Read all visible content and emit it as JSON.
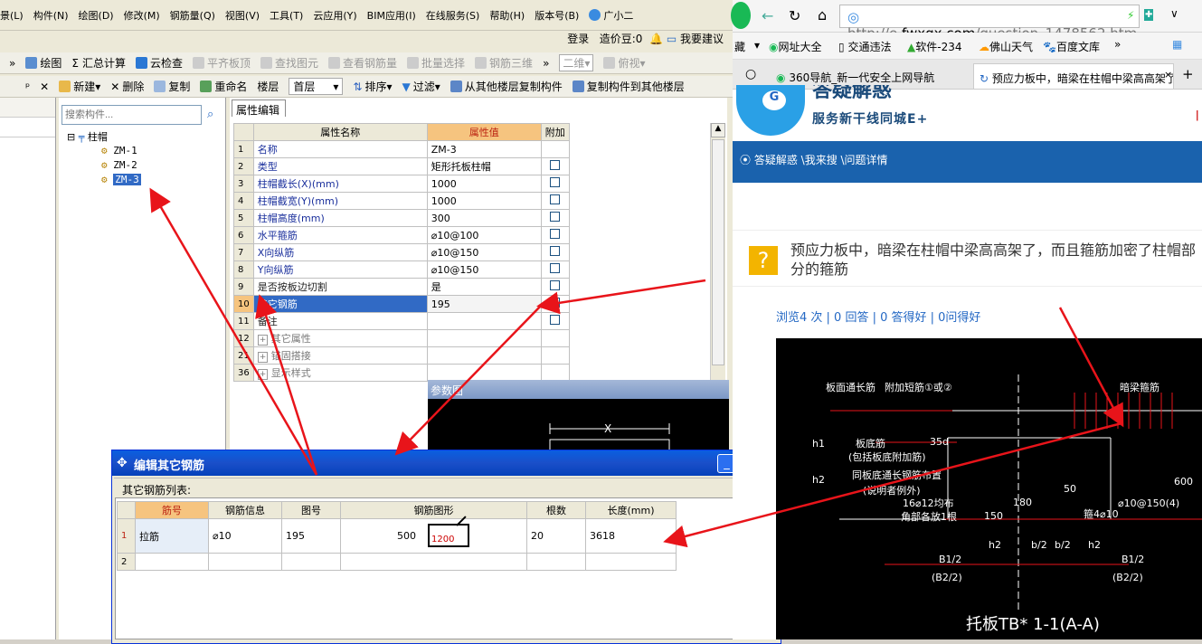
{
  "menu": {
    "items": [
      "景(L)",
      "构件(N)",
      "绘图(D)",
      "修改(M)",
      "钢筋量(Q)",
      "视图(V)",
      "工具(T)",
      "云应用(Y)",
      "BIM应用(I)",
      "在线服务(S)",
      "帮助(H)",
      "版本号(B)",
      "广小二"
    ]
  },
  "account": {
    "login": "登录",
    "price_bean": "造价豆:0",
    "suggest": "我要建议"
  },
  "toolbar1": {
    "items": [
      "绘图",
      "汇总计算",
      "云检查",
      "平齐板顶",
      "查找图元",
      "查看钢筋量",
      "批量选择",
      "钢筋三维",
      "二维",
      "俯视"
    ]
  },
  "toolbar2": {
    "new": "新建",
    "delete": "删除",
    "copy": "复制",
    "rename": "重命名",
    "floor_label": "楼层",
    "floor_value": "首层",
    "sort": "排序",
    "filter": "过滤",
    "copy_from": "从其他楼层复制构件",
    "copy_to": "复制构件到其他楼层"
  },
  "tree": {
    "search_placeholder": "搜索构件...",
    "root": "柱帽",
    "items": [
      "ZM-1",
      "ZM-2",
      "ZM-3"
    ]
  },
  "property": {
    "tab": "属性编辑",
    "headers": {
      "name": "属性名称",
      "value": "属性值",
      "extra": "附加"
    },
    "rows": [
      {
        "no": "1",
        "name": "名称",
        "value": "ZM-3"
      },
      {
        "no": "2",
        "name": "类型",
        "value": "矩形托板柱帽"
      },
      {
        "no": "3",
        "name": "柱帽截长(X)(mm)",
        "value": "1000"
      },
      {
        "no": "4",
        "name": "柱帽截宽(Y)(mm)",
        "value": "1000"
      },
      {
        "no": "5",
        "name": "柱帽高度(mm)",
        "value": "300"
      },
      {
        "no": "6",
        "name": "水平箍筋",
        "value": "⌀10@100"
      },
      {
        "no": "7",
        "name": "X向纵筋",
        "value": "⌀10@150"
      },
      {
        "no": "8",
        "name": "Y向纵筋",
        "value": "⌀10@150"
      },
      {
        "no": "9",
        "name": "是否按板边切割",
        "value": "是"
      },
      {
        "no": "10",
        "name": "其它钢筋",
        "value": "195"
      },
      {
        "no": "11",
        "name": "备注",
        "value": ""
      },
      {
        "no": "12",
        "name": "其它属性",
        "value": ""
      },
      {
        "no": "21",
        "name": "锚固搭接",
        "value": ""
      },
      {
        "no": "36",
        "name": "显示样式",
        "value": ""
      }
    ]
  },
  "reference": {
    "title": "参数图",
    "x_label": "X"
  },
  "dialog": {
    "title": "编辑其它钢筋",
    "list_label": "其它钢筋列表:",
    "headers": [
      "筋号",
      "钢筋信息",
      "图号",
      "钢筋图形",
      "根数",
      "长度(mm)"
    ],
    "row": {
      "no": "1",
      "bar": "拉筋",
      "info": "⌀10",
      "fig": "195",
      "shape_a": "500",
      "shape_b": "1200",
      "count": "20",
      "length": "3618"
    },
    "row2_no": "2"
  },
  "browser": {
    "url_prefix": "http://e.",
    "url_domain": "fwxgx.com",
    "url_path": "/question_1478562.htm",
    "bookmarks": [
      "藏",
      "网址大全",
      "交通违法",
      "软件-234",
      "佛山天气",
      "百度文库"
    ],
    "tab1": "360导航_新一代安全上网导航",
    "tab2": "预应力板中，暗梁在柱帽中梁高高架了",
    "site_title": "答疑解惑",
    "site_slogan": "服务新干线同城E+",
    "breadcrumb": "答疑解惑 \\我来搜 \\问题详情",
    "question": "预应力板中，暗梁在柱帽中梁高高架了，而且箍筋加密了柱帽部分的箍筋",
    "stats": "浏览4 次 | 0 回答 | 0 答得好 | 0问得好"
  },
  "cad": {
    "labels": [
      "板面通长筋",
      "附加短筋①或②",
      "暗梁箍筋",
      "板底筋",
      "(包括板底附加筋)",
      "同板底通长钢筋布置",
      "(说明者例外)",
      "16⌀12均布",
      "角部各放1根",
      "⌀10@150(4)",
      "箍4⌀10",
      "35d",
      "h1",
      "h2",
      "h2",
      "b/2",
      "b/2",
      "h2",
      "B1/2",
      "(B2/2)",
      "B1/2",
      "(B2/2)",
      "600",
      "150",
      "50",
      "180",
      "托板TB* 1-1(A-A)"
    ]
  },
  "colors": {
    "accent_blue": "#316ac5",
    "header_orange": "#f6c47f",
    "site_blue": "#1a62ad",
    "arrow_red": "#e8141a"
  }
}
